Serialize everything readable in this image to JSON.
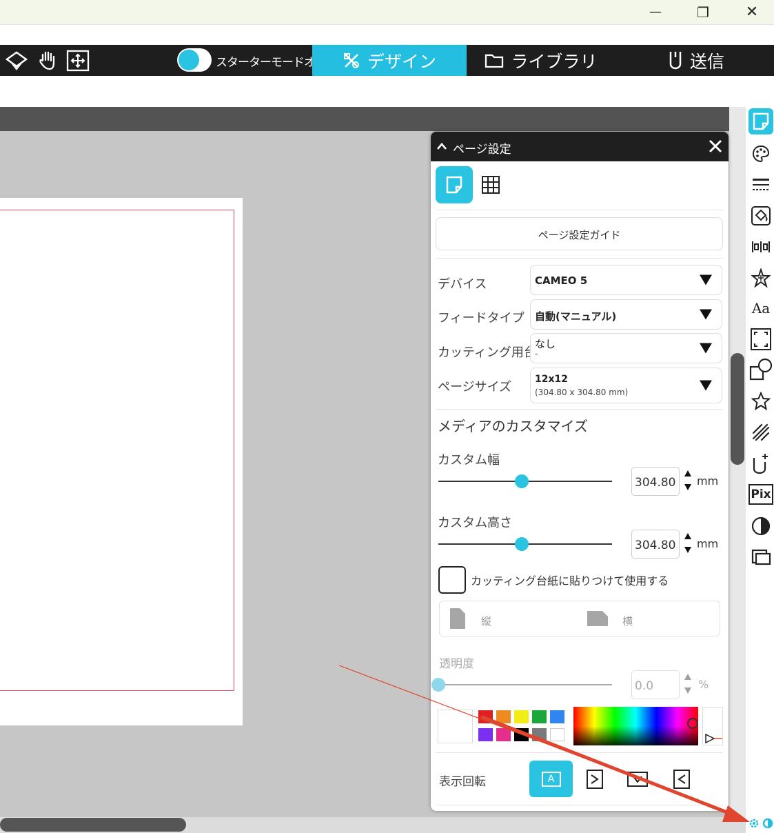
{
  "window": {
    "minimize": "—",
    "restore": "❐",
    "close": "✕"
  },
  "toolbar": {
    "tools": [
      {
        "name": "select-tool-icon"
      },
      {
        "name": "hand-tool-icon"
      },
      {
        "name": "move-tool-icon"
      }
    ],
    "starter_mode_label": "スターターモードオフ",
    "tabs": [
      {
        "label": "デザイン",
        "icon": "design-icon",
        "active": true
      },
      {
        "label": "ライブラリ",
        "icon": "folder-icon",
        "active": false
      },
      {
        "label": "送信",
        "icon": "send-icon",
        "active": false
      }
    ]
  },
  "panel": {
    "title": "ページ設定",
    "guide_button": "ページ設定ガイド",
    "rows": [
      {
        "label": "デバイス",
        "value": "CAMEO 5",
        "sub": ""
      },
      {
        "label": "フィードタイプ",
        "value": "自動(マニュアル)",
        "sub": ""
      },
      {
        "label": "カッティング用台紙",
        "value": "なし",
        "sub": "-"
      },
      {
        "label": "ページサイズ",
        "value": "12x12",
        "sub": "(304.80 x 304.80 mm)"
      }
    ],
    "media_heading": "メディアのカスタマイズ",
    "custom_width": {
      "label": "カスタム幅",
      "value": "304.80",
      "unit": "mm",
      "fraction": 0.48
    },
    "custom_height": {
      "label": "カスタム高さ",
      "value": "304.80",
      "unit": "mm",
      "fraction": 0.48
    },
    "mat_checkbox_label": "カッティング台紙に貼りつけて使用する",
    "orientation": {
      "portrait": "縦",
      "landscape": "横"
    },
    "transparency": {
      "label": "透明度",
      "value": "0.0",
      "unit": "%",
      "fraction": 0.0
    },
    "swatches": [
      "#e02020",
      "#ee8a22",
      "#f2ee14",
      "#1aa83a",
      "#2f86f0",
      "#7b2ff0",
      "#e62d8a",
      "#000000",
      "#7a7a7a",
      "#ffffff"
    ],
    "rotation_label": "表示回転",
    "rotation_button_label": "A"
  },
  "right_panel_icons": [
    "page-setup-icon",
    "palette-icon",
    "line-style-icon",
    "fill-icon",
    "align-icon",
    "transform-icon",
    "text-style-icon",
    "scale-icon",
    "modify-icon",
    "effects-icon",
    "sketch-icon",
    "offset-icon",
    "pixscan-icon",
    "trace-icon",
    "library-panel-icon"
  ],
  "right_panel_text": {
    "text_style": "Aa",
    "pixscan": "Pix"
  },
  "colors": {
    "accent": "#24bfe0",
    "annotation_arrow": "#e0452f",
    "cut_line": "#ee4a5a"
  }
}
